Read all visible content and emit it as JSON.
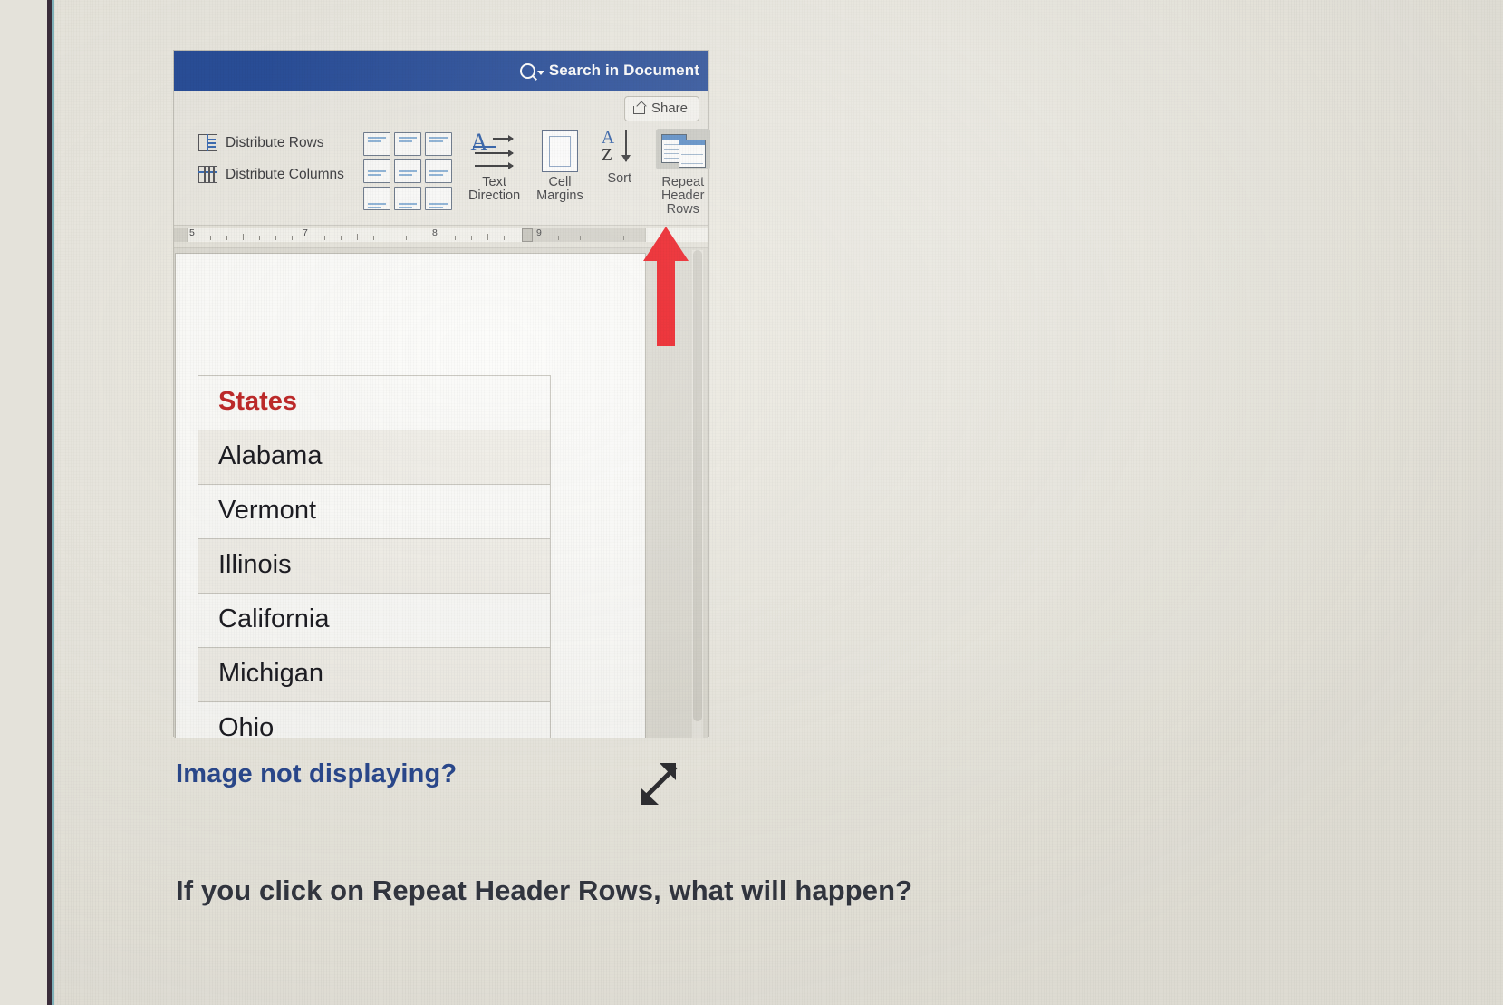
{
  "word_window": {
    "titlebar": {
      "search_label": "Search in Document",
      "search_icon": "magnifier-with-caret-icon",
      "bg_color": "#2a4f9b"
    },
    "share_button": {
      "label": "Share",
      "icon": "share-arrow-icon"
    },
    "ribbon": {
      "group_cells": [
        {
          "label": "Distribute Rows",
          "icon": "distribute-rows-icon"
        },
        {
          "label": "Distribute Columns",
          "icon": "distribute-columns-icon"
        }
      ],
      "alignment_gallery": {
        "name": "cell-alignment-gallery",
        "cells": 9
      },
      "text_direction": {
        "line1": "Text",
        "line2": "Direction",
        "icon": "text-direction-icon"
      },
      "cell_margins": {
        "line1": "Cell",
        "line2": "Margins",
        "icon": "cell-margins-icon"
      },
      "sort": {
        "line1": "Sort",
        "line2": "",
        "icon": "sort-az-descending-icon"
      },
      "repeat_header_rows": {
        "line1": "Repeat",
        "line2": "Header Rows",
        "icon": "repeat-header-rows-icon",
        "selected": true
      }
    },
    "ruler": {
      "numbers": [
        "5",
        "7",
        "8",
        "9"
      ]
    },
    "document_table": {
      "header": "States",
      "header_color": "#c02a2a",
      "rows": [
        "Alabama",
        "Vermont",
        "Illinois",
        "California",
        "Michigan",
        "Ohio"
      ]
    },
    "annotation": {
      "arrow": "red-up-arrow-pointing-to-repeat-header-rows",
      "arrow_color": "#ef2027"
    }
  },
  "quiz": {
    "image_fallback_link": "Image not displaying?",
    "expand_icon": "expand-diagonal-arrows-icon",
    "question": "If you click on Repeat Header Rows, what will happen?",
    "link_color": "#2b4a91",
    "question_color": "#343842"
  }
}
